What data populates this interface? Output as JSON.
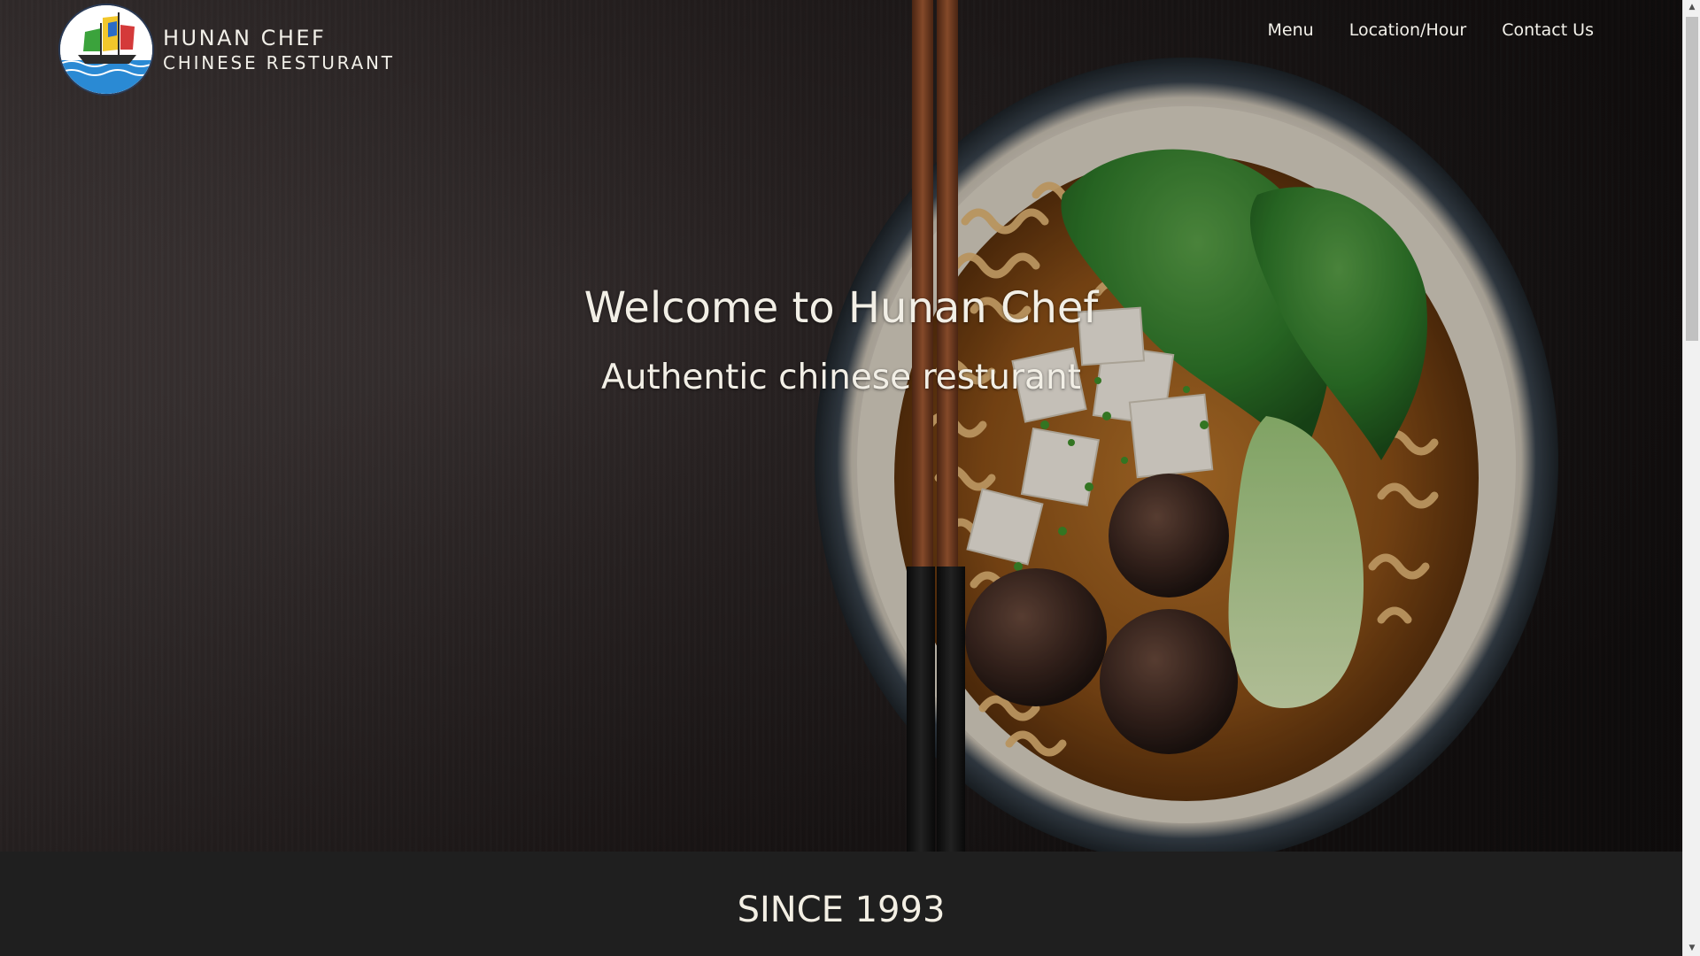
{
  "brand": {
    "name": "HUNAN CHEF",
    "subtitle": "CHINESE RESTURANT",
    "logo_icon": "sailing-ship-logo"
  },
  "nav": {
    "items": [
      {
        "label": "Menu"
      },
      {
        "label": "Location/Hour"
      },
      {
        "label": "Contact Us"
      }
    ]
  },
  "hero": {
    "title": "Welcome to Hunan Chef",
    "subtitle": "Authentic chinese resturant",
    "background_image": "bowl-of-ramen-with-chopsticks"
  },
  "since": {
    "title": "SINCE 1993"
  },
  "colors": {
    "hero_text": "#f2efe6",
    "section_bg": "#1f1f1f",
    "scrollbar_thumb": "#c1c1c1"
  }
}
